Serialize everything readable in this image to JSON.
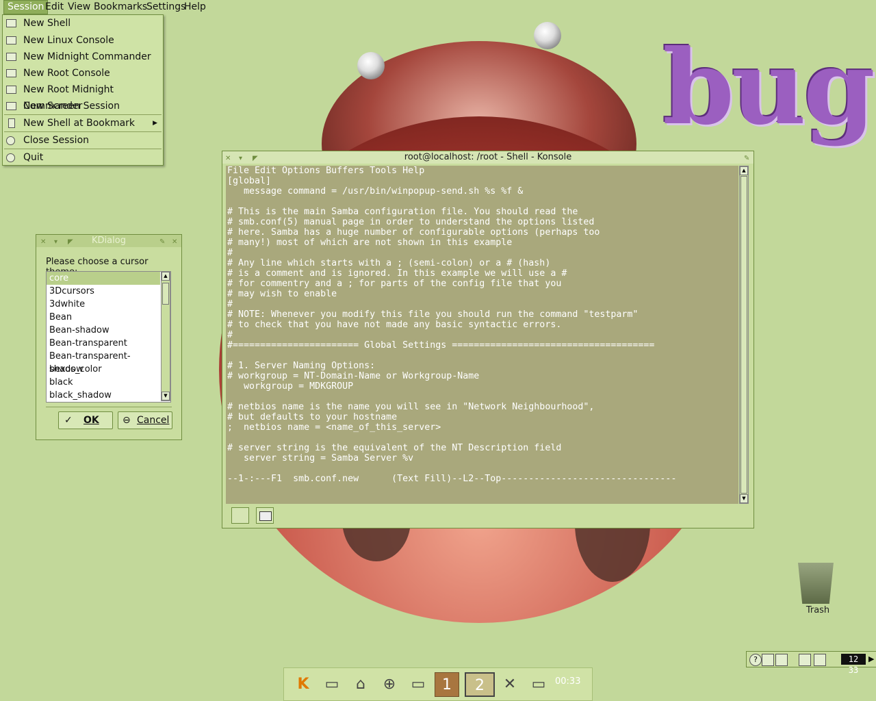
{
  "desktop": {
    "wallpaper_word": "bug",
    "trash_label": "Trash",
    "background_color": "#c2d89a"
  },
  "menubar": {
    "items": [
      "Session",
      "Edit",
      "View",
      "Bookmarks",
      "Settings",
      "Help"
    ],
    "active": "Session"
  },
  "session_menu": {
    "items": [
      {
        "label": "New Shell",
        "icon": "terminal-icon"
      },
      {
        "label": "New Linux Console",
        "icon": "terminal-icon"
      },
      {
        "label": "New Midnight Commander",
        "icon": "terminal-icon"
      },
      {
        "label": "New Root Console",
        "icon": "terminal-icon"
      },
      {
        "label": "New Root Midnight Commander",
        "icon": "terminal-icon"
      },
      {
        "label": "New Screen Session",
        "icon": "terminal-icon"
      },
      {
        "label": "New Shell at Bookmark",
        "icon": "bookmark-icon",
        "submenu": true
      },
      {
        "label": "Close Session",
        "icon": "close-session-icon"
      },
      {
        "label": "Quit",
        "icon": "quit-icon"
      }
    ]
  },
  "kdialog": {
    "title": "KDialog",
    "prompt": "Please choose a cursor theme:",
    "options": [
      "core",
      "3Dcursors",
      "3dwhite",
      "Bean",
      "Bean-shadow",
      "Bean-transparent",
      "Bean-transparent-shadow",
      "bexos_color",
      "black",
      "black_shadow"
    ],
    "selected": "core",
    "ok_label": "OK",
    "cancel_label": "Cancel"
  },
  "konsole": {
    "title": "root@localhost: /root - Shell - Konsole",
    "lines": [
      "File Edit Options Buffers Tools Help",
      "[global]",
      "   message command = /usr/bin/winpopup-send.sh %s %f &",
      "",
      "# This is the main Samba configuration file. You should read the",
      "# smb.conf(5) manual page in order to understand the options listed",
      "# here. Samba has a huge number of configurable options (perhaps too",
      "# many!) most of which are not shown in this example",
      "#",
      "# Any line which starts with a ; (semi-colon) or a # (hash)",
      "# is a comment and is ignored. In this example we will use a #",
      "# for commentry and a ; for parts of the config file that you",
      "# may wish to enable",
      "#",
      "# NOTE: Whenever you modify this file you should run the command \"testparm\"",
      "# to check that you have not made any basic syntactic errors.",
      "#",
      "#======================= Global Settings =====================================",
      "",
      "# 1. Server Naming Options:",
      "# workgroup = NT-Domain-Name or Workgroup-Name",
      "   workgroup = MDKGROUP",
      "",
      "# netbios name is the name you will see in \"Network Neighbourhood\",",
      "# but defaults to your hostname",
      ";  netbios name = <name_of_this_server>",
      "",
      "# server string is the equivalent of the NT Description field",
      "   server string = Samba Server %v",
      "",
      "--1-:---F1  smb.conf.new      (Text Fill)--L2--Top--------------------------------"
    ]
  },
  "taskbar": {
    "clock": "00:33",
    "items": [
      "kde-menu-icon",
      "window-list-icon",
      "home-icon",
      "help-lifesaver-icon",
      "terminal-icon",
      "desktop-1-icon",
      "desktop-2-icon",
      "close-x-icon",
      "terminal-icon"
    ]
  },
  "systray": {
    "clock": "12 33"
  }
}
